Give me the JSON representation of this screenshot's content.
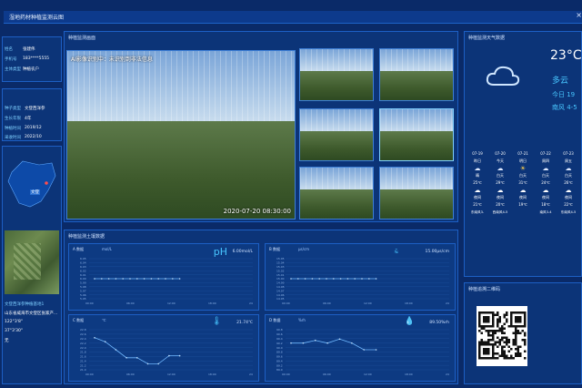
{
  "title": "湿地药材种植监测云图",
  "close_icon": "×",
  "user": {
    "name_label": "姓名",
    "name": "张建伟",
    "phone_label": "手机号",
    "phone": "183****5555",
    "role_label": "主体类型",
    "role": "种植农户"
  },
  "crop": {
    "type_label": "种子类型",
    "type": "文登西洋参",
    "age_label": "生长年限",
    "age": "4年",
    "plant_label": "种植时间",
    "plant": "2019/12",
    "harvest_label": "采收时间",
    "harvest": "2022/10"
  },
  "map": {
    "marker_label": "文登"
  },
  "plot": {
    "name": "文登西洋参种植基地1",
    "addr": "山东省威海市文登区张家产...",
    "coords": "122°3'8\"",
    "coords2": "37°3'30\"",
    "status": "无"
  },
  "camera": {
    "title": "种植监测画面",
    "overlay": "AI影像识别中：未识别到非法信息",
    "timestamp": "2020-07-20 08:30:00"
  },
  "weather": {
    "title": "种植监测天气数据",
    "temp": "23°C",
    "condition": "多云",
    "today": "今日 19",
    "wind": "南风 4-5",
    "days": [
      {
        "date": "07-19",
        "name": "昨日",
        "sky": "晴",
        "hi": "25℃",
        "night": "夜间",
        "lo": "21℃",
        "wind": "东南风3-"
      },
      {
        "date": "07-20",
        "name": "今天",
        "sky": "白天",
        "hi": "29℃",
        "night": "夜间",
        "lo": "20℃",
        "wind": "西南风4-5"
      },
      {
        "date": "07-21",
        "name": "明日",
        "sky": "白天",
        "hi": "31℃",
        "night": "夜间",
        "lo": "19℃",
        "wind": ""
      },
      {
        "date": "07-22",
        "name": "周四",
        "sky": "白天",
        "hi": "24℃",
        "night": "夜间",
        "lo": "18℃",
        "wind": "南风3-4"
      },
      {
        "date": "07-23",
        "name": "周五",
        "sky": "白天",
        "hi": "26℃",
        "night": "夜间",
        "lo": "22℃",
        "wind": "东南风4-5"
      }
    ]
  },
  "soil": {
    "title": "种植监测土壤数据",
    "charts": [
      {
        "name": "A 数据",
        "unit": "mol/L",
        "big": "pH",
        "value": "6.00mol/L"
      },
      {
        "name": "B 数据",
        "unit": "μs/cm",
        "value": "15.00μs/cm"
      },
      {
        "name": "C 数据",
        "unit": "℃",
        "value": "21.74℃"
      },
      {
        "name": "D 数据",
        "unit": "%rh",
        "value": "89.50%rh"
      }
    ]
  },
  "qr_title": "种植追溯二维码",
  "colors": {
    "bg": "#0a2a68",
    "panel": "#0c3478",
    "accent": "#48c6ff",
    "line": "#6fb8ff"
  },
  "chart_data": [
    {
      "type": "line",
      "ylim": [
        5.95,
        6.05
      ],
      "yticks": [
        "6.05",
        "6.04",
        "6.03",
        "6.02",
        "6.01",
        "6.00",
        "5.99",
        "5.98",
        "5.97",
        "5.96",
        "5.95"
      ],
      "x": [
        "00:00",
        "06:00",
        "12:00",
        "18:00",
        "24:00"
      ],
      "values": [
        6.0,
        6.0,
        6.0,
        6.0,
        6.0,
        6.0,
        6.0,
        6.0,
        6.0,
        6.0,
        6.0,
        6.0,
        6.0
      ]
    },
    {
      "type": "line",
      "ylim": [
        14.95,
        15.05
      ],
      "yticks": [
        "15.05",
        "15.04",
        "15.03",
        "15.02",
        "15.01",
        "15.00",
        "14.99",
        "14.98",
        "14.97",
        "14.96",
        "14.95"
      ],
      "x": [
        "00:00",
        "06:00",
        "12:00",
        "18:00",
        "24:00"
      ],
      "values": [
        15.0,
        15.0,
        15.0,
        15.0,
        15.0,
        15.0,
        15.0,
        15.0,
        15.0,
        15.0,
        15.0,
        15.0,
        15.0
      ]
    },
    {
      "type": "line",
      "ylim": [
        21.0,
        23.0
      ],
      "yticks": [
        "22.8",
        "22.6",
        "22.4",
        "22.2",
        "22.0",
        "21.8",
        "21.6",
        "21.4",
        "21.2",
        "21.0"
      ],
      "x": [
        "00:00",
        "06:00",
        "12:00",
        "18:00",
        "24:00"
      ],
      "values": [
        22.6,
        22.4,
        22.0,
        21.6,
        21.6,
        21.3,
        21.3,
        21.7,
        21.7
      ]
    },
    {
      "type": "line",
      "ylim": [
        88.0,
        91.0
      ],
      "yticks": [
        "90.8",
        "90.6",
        "90.4",
        "90.2",
        "90.0",
        "89.8",
        "89.6",
        "89.4",
        "89.2",
        "89.0"
      ],
      "x": [
        "00:00",
        "06:00",
        "12:00",
        "18:00",
        "24:00"
      ],
      "values": [
        90.0,
        90.0,
        90.2,
        90.0,
        90.3,
        90.0,
        89.5,
        89.5
      ]
    }
  ]
}
